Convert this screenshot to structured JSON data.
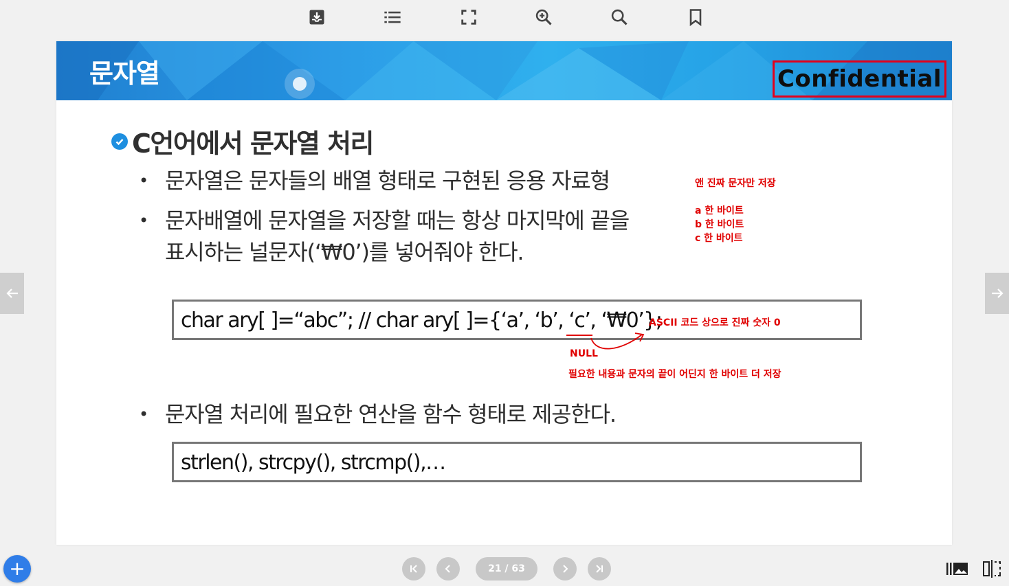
{
  "toolbar": {
    "icons": [
      "download-icon",
      "list-icon",
      "fullscreen-icon",
      "zoom-in-icon",
      "search-icon",
      "bookmark-icon"
    ]
  },
  "slide": {
    "banner_title": "문자열",
    "confidential": "Confidential",
    "heading": "C언어에서 문자열 처리",
    "bullet_symbol": "•",
    "bullets": [
      {
        "lines": [
          "문자열은 문자들의 배열 형태로 구현된 응용 자료형"
        ]
      },
      {
        "lines": [
          "문자배열에 문자열을 저장할 때는 항상 마지막에 끝을",
          "표시하는 널문자(‘₩0’)를 넣어줘야 한다."
        ]
      },
      {
        "lines": [
          "문자열 처리에 필요한 연산을 함수 형태로 제공한다."
        ]
      }
    ],
    "code1": "char ary[ ]=“abc”;   // char ary[ ]={‘a’, ‘b’, ‘c’, ‘₩0’};",
    "code2": "strlen(), strcpy(), strcmp(),…",
    "notes": {
      "real_chars": "앤 진짜 문자만 저장",
      "byte_a": "a 한 바이트",
      "byte_b": "b 한 바이트",
      "byte_c": "c 한 바이트",
      "ascii": "ASCII 코드 상으로 진짜 숫자 0",
      "null": "NULL",
      "extra": "필요한 내용과 문자의 끝이 어딘지 한 바이트 더 저장"
    },
    "annotation_color": "#e00000"
  },
  "navigation": {
    "page_indicator": "21 / 63",
    "prev_slide_icon": "arrow-left-icon",
    "next_slide_icon": "arrow-right-icon",
    "add_button": "+"
  }
}
